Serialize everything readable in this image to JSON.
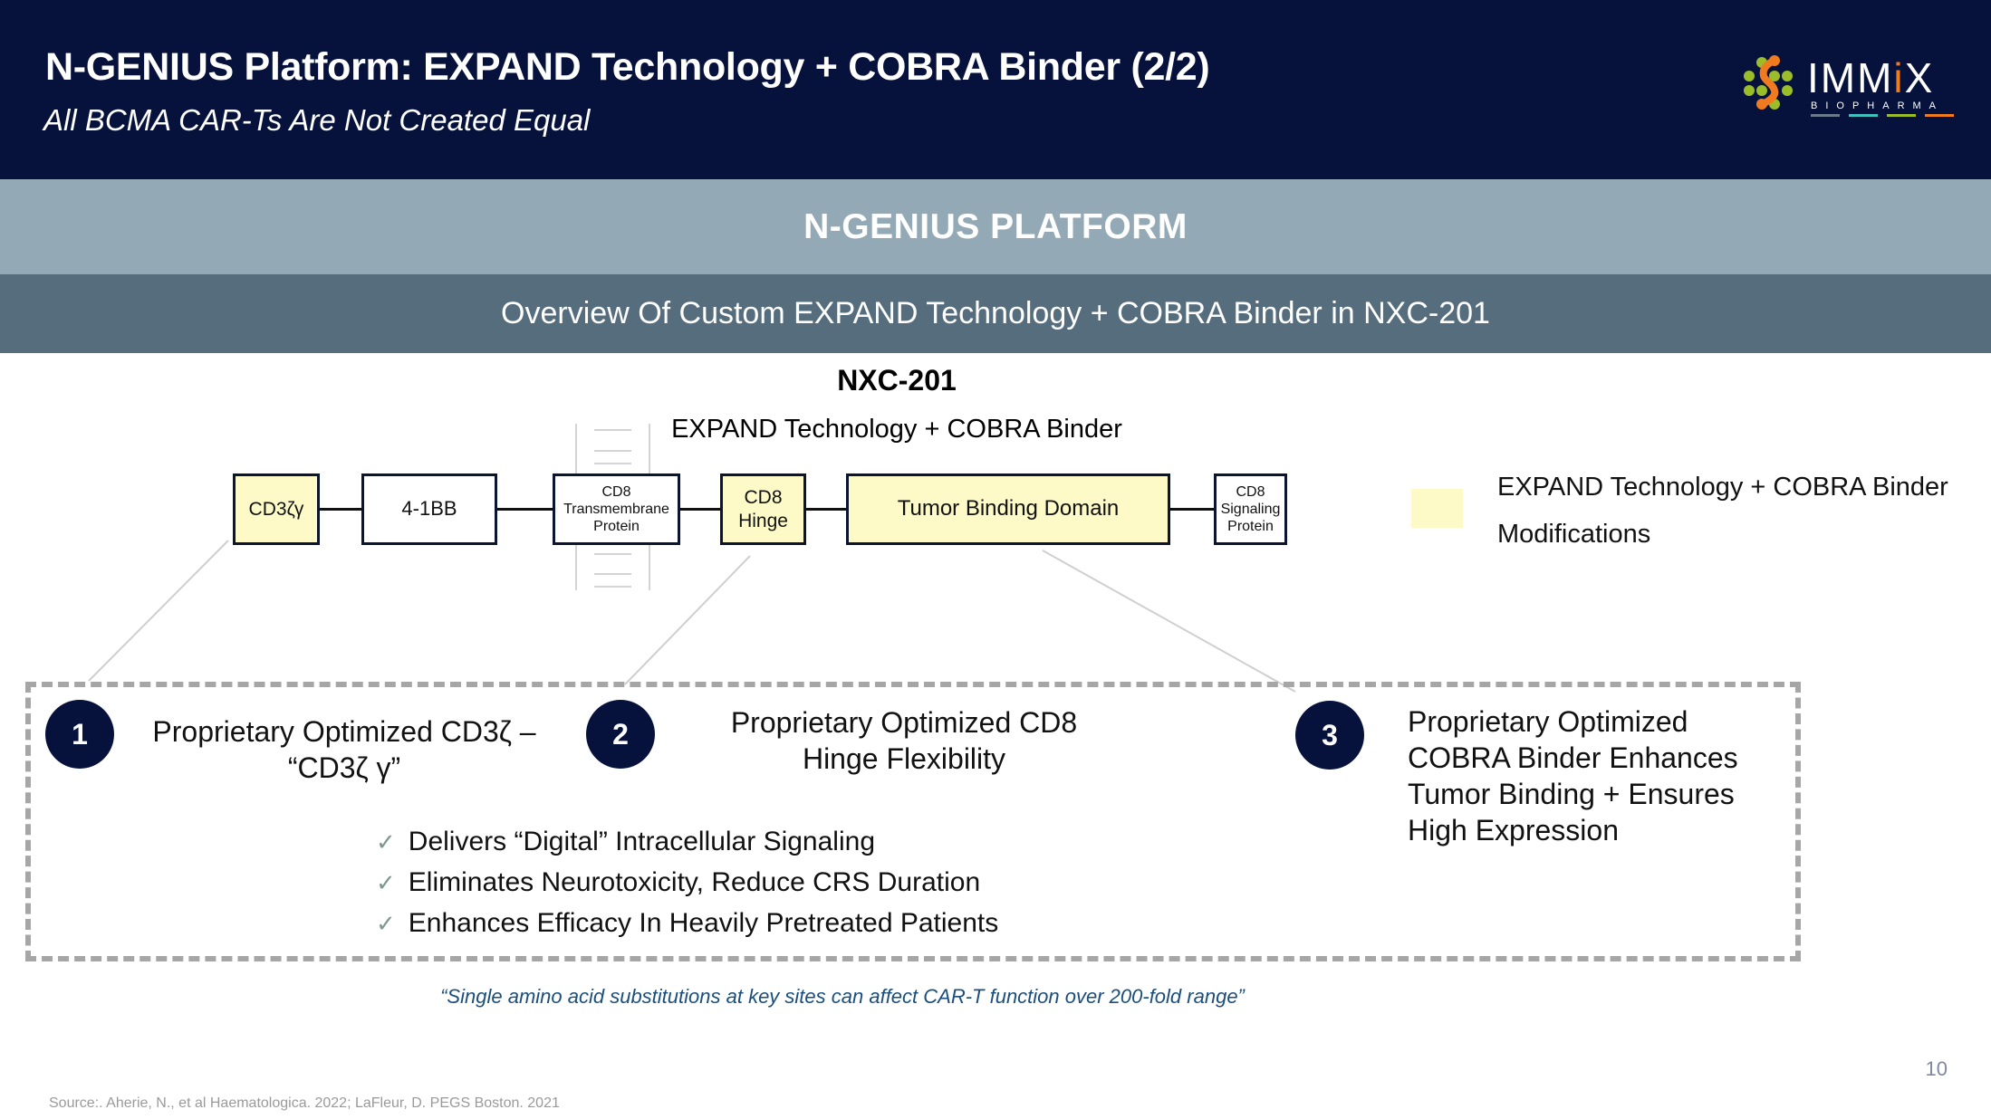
{
  "header": {
    "title": "N-GENIUS Platform: EXPAND Technology + COBRA Binder  (2/2)",
    "subtitle": "All BCMA CAR-Ts Are Not Created Equal",
    "logo": {
      "name": "IMMiX",
      "tagline": "BIOPHARMA",
      "colors": {
        "dots": "#9bbd2a",
        "accent": "#f07b1e",
        "bar1": "#6c7a8c",
        "bar2": "#3fc1c0",
        "bar3": "#9bbd2a",
        "bar4": "#f07b1e"
      }
    }
  },
  "bands": {
    "platform": "N-GENIUS PLATFORM",
    "overview": "Overview Of Custom EXPAND Technology + COBRA Binder in NXC-201"
  },
  "diagram": {
    "title": "NXC-201",
    "subtitle": "EXPAND Technology + COBRA Binder",
    "components": [
      {
        "label": "CD3ζγ",
        "highlighted": true
      },
      {
        "label": "4-1BB",
        "highlighted": false
      },
      {
        "label": "CD8 Transmembrane Protein",
        "lines": [
          "CD8",
          "Transmembrane",
          "Protein"
        ],
        "highlighted": false
      },
      {
        "label": "CD8 Hinge",
        "lines": [
          "CD8",
          "Hinge"
        ],
        "highlighted": true
      },
      {
        "label": "Tumor Binding Domain",
        "highlighted": true
      },
      {
        "label": "CD8 Signaling Protein",
        "lines": [
          "CD8",
          "Signaling",
          "Protein"
        ],
        "highlighted": false
      }
    ],
    "legend": {
      "line1": "EXPAND Technology + COBRA Binder",
      "line2": "Modifications",
      "color": "#fdfac8"
    }
  },
  "features": [
    {
      "number": "1",
      "text_lines": [
        "Proprietary Optimized CD3ζ –",
        "“CD3ζ γ”"
      ]
    },
    {
      "number": "2",
      "text_lines": [
        "Proprietary Optimized CD8",
        "Hinge Flexibility"
      ]
    },
    {
      "number": "3",
      "text_lines": [
        "Proprietary Optimized",
        "COBRA Binder Enhances",
        "Tumor Binding + Ensures",
        "High Expression"
      ]
    }
  ],
  "benefits": {
    "check_icon": "✓",
    "items": [
      "Delivers “Digital” Intracellular Signaling",
      "Eliminates Neurotoxicity, Reduce CRS Duration",
      "Enhances Efficacy In Heavily Pretreated Patients"
    ]
  },
  "quote": "“Single amino acid substitutions at key sites can affect CAR-T function over 200-fold range”",
  "footer": {
    "source": "Source:. Aherie, N., et al Haematologica. 2022; LaFleur, D. PEGS Boston. 2021",
    "page_number": "10"
  }
}
